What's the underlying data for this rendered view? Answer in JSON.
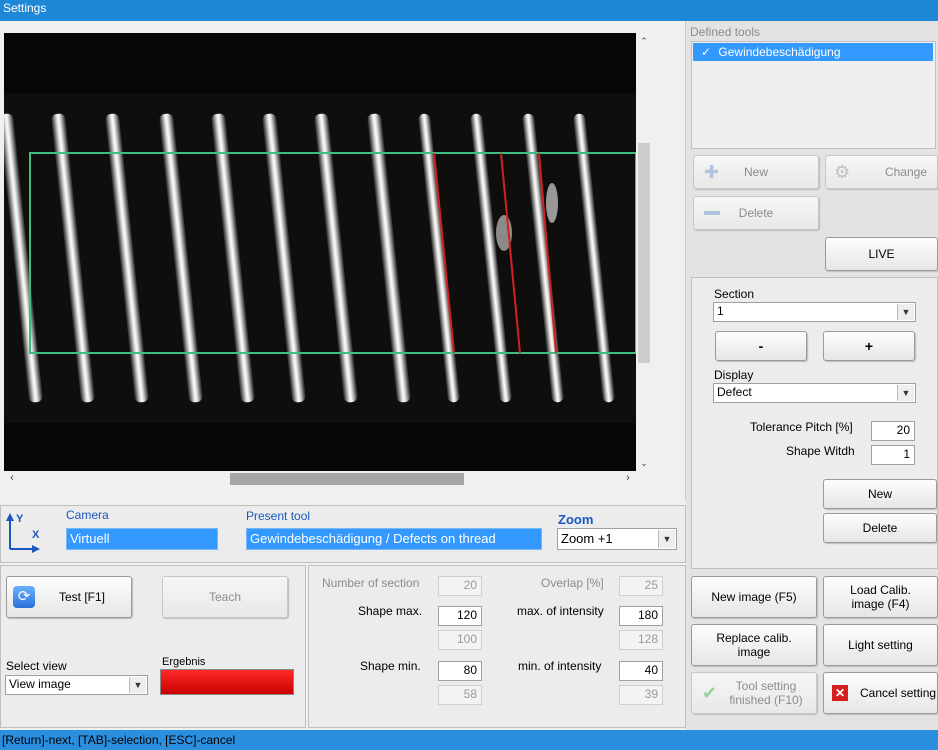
{
  "window": {
    "title": "Settings"
  },
  "defined_tools": {
    "label": "Defined tools",
    "items": [
      {
        "label": "Gewindebeschädigung",
        "checked": true
      }
    ],
    "check_mark": "✓"
  },
  "tool_buttons": {
    "new": "New",
    "change": "Change",
    "delete": "Delete",
    "live": "LIVE"
  },
  "section": {
    "label": "Section",
    "value": "1",
    "minus": "-",
    "plus": "+",
    "display_label": "Display",
    "display_value": "Defect",
    "tolerance_pitch_label": "Tolerance Pitch [%]",
    "tolerance_pitch_value": "20",
    "shape_width_label": "Shape Witdh",
    "shape_width_value": "1",
    "new_button": "New",
    "delete_button": "Delete"
  },
  "info": {
    "axis_y": "Y",
    "axis_x": "X",
    "camera_label": "Camera",
    "camera_value": "Virtuell",
    "present_tool_label": "Present tool",
    "present_tool_value": "Gewindebeschädigung / Defects on thread",
    "zoom_label": "Zoom",
    "zoom_value": "Zoom +1"
  },
  "left_controls": {
    "test_button": "Test [F1]",
    "teach_button": "Teach",
    "select_view_label": "Select view",
    "select_view_value": "View image",
    "ergebnis_label": "Ergebnis",
    "ergebnis_color": "#e01010"
  },
  "params": {
    "number_of_section_label": "Number of section",
    "number_of_section_value": "20",
    "overlap_label": "Overlap [%]",
    "overlap_value": "25",
    "shape_max_label": "Shape max.",
    "shape_max_value": "120",
    "shape_max_ref": "100",
    "max_intensity_label": "max. of intensity",
    "max_intensity_value": "180",
    "max_intensity_ref": "128",
    "shape_min_label": "Shape min.",
    "shape_min_value": "80",
    "shape_min_ref": "58",
    "min_intensity_label": "min. of intensity",
    "min_intensity_value": "40",
    "min_intensity_ref": "39"
  },
  "action_buttons": {
    "new_image": "New image (F5)",
    "load_calib_line1": "Load Calib.",
    "load_calib_line2": "image (F4)",
    "replace_calib_line1": "Replace calib.",
    "replace_calib_line2": "image",
    "light_setting": "Light setting",
    "tool_setting_line1": "Tool setting",
    "tool_setting_line2": "finished (F10)",
    "cancel_setting": "Cancel setting"
  },
  "status": {
    "text": "[Return]-next, [TAB]-selection, [ESC]-cancel"
  },
  "colors": {
    "roi": "#3fbf7f",
    "defect": "#d42020",
    "accent": "#1e88d6",
    "selection": "#3399ff"
  }
}
